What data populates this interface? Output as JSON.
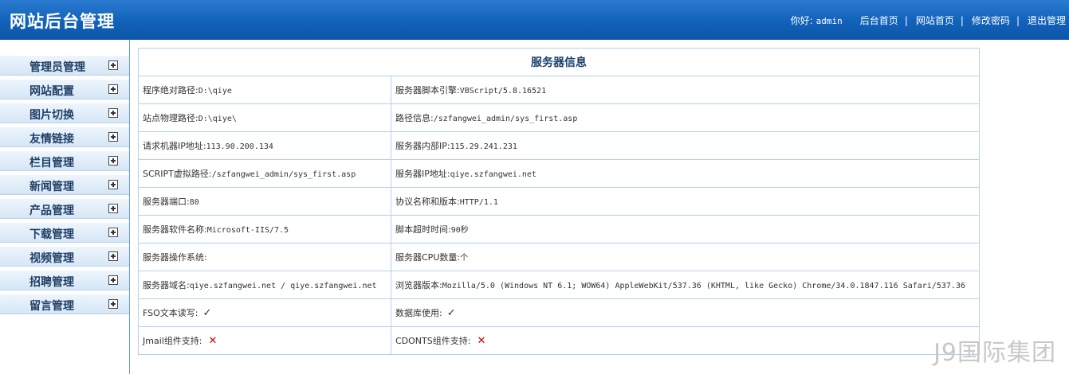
{
  "header": {
    "title": "网站后台管理",
    "greeting": "你好:",
    "username": "admin",
    "nav": [
      "后台首页",
      "网站首页",
      "修改密码",
      "退出管理"
    ],
    "separator": "|"
  },
  "sidebar": {
    "items": [
      {
        "label": "管理员管理"
      },
      {
        "label": "网站配置"
      },
      {
        "label": "图片切换"
      },
      {
        "label": "友情链接"
      },
      {
        "label": "栏目管理"
      },
      {
        "label": "新闻管理"
      },
      {
        "label": "产品管理"
      },
      {
        "label": "下载管理"
      },
      {
        "label": "视频管理"
      },
      {
        "label": "招聘管理"
      },
      {
        "label": "留言管理"
      }
    ]
  },
  "server_info": {
    "title": "服务器信息",
    "rows": [
      [
        {
          "label": "程序绝对路径:",
          "value": "D:\\qiye"
        },
        {
          "label": "服务器脚本引擎:",
          "value": "VBScript/5.8.16521"
        }
      ],
      [
        {
          "label": "站点物理路径:",
          "value": "D:\\qiye\\"
        },
        {
          "label": "路径信息:",
          "value": "/szfangwei_admin/sys_first.asp"
        }
      ],
      [
        {
          "label": "请求机器IP地址:",
          "value": "113.90.200.134"
        },
        {
          "label": "服务器内部IP:",
          "value": "115.29.241.231"
        }
      ],
      [
        {
          "label": "SCRIPT虚拟路径:",
          "value": "/szfangwei_admin/sys_first.asp"
        },
        {
          "label": "服务器IP地址:",
          "value": "qiye.szfangwei.net"
        }
      ],
      [
        {
          "label": "服务器端口:",
          "value": "80"
        },
        {
          "label": "协议名称和版本:",
          "value": "HTTP/1.1"
        }
      ],
      [
        {
          "label": "服务器软件名称:",
          "value": "Microsoft-IIS/7.5"
        },
        {
          "label": "脚本超时时间:",
          "value": "90秒"
        }
      ],
      [
        {
          "label": "服务器操作系统:",
          "value": ""
        },
        {
          "label": "服务器CPU数量:",
          "value": "个"
        }
      ],
      [
        {
          "label": "服务器域名:",
          "value": "qiye.szfangwei.net / qiye.szfangwei.net"
        },
        {
          "label": "浏览器版本:",
          "value": "Mozilla/5.0 (Windows NT 6.1; WOW64) AppleWebKit/537.36 (KHTML, like Gecko) Chrome/34.0.1847.116 Safari/537.36"
        }
      ]
    ],
    "support": [
      {
        "label": "FSO文本读写:",
        "status": "✓"
      },
      {
        "label": "数据库使用:",
        "status": "✓"
      },
      {
        "label": "Jmail组件支持:",
        "status": "✕"
      },
      {
        "label": "CDONTS组件支持:",
        "status": "✕"
      }
    ]
  },
  "watermark": "J9国际集团",
  "colors": {
    "header_blue": "#1465bd",
    "sidebar_bg": "#d6e6f6",
    "table_border": "#b5d0ea",
    "title_text": "#1b3f6d",
    "cross_red": "#d00000"
  }
}
